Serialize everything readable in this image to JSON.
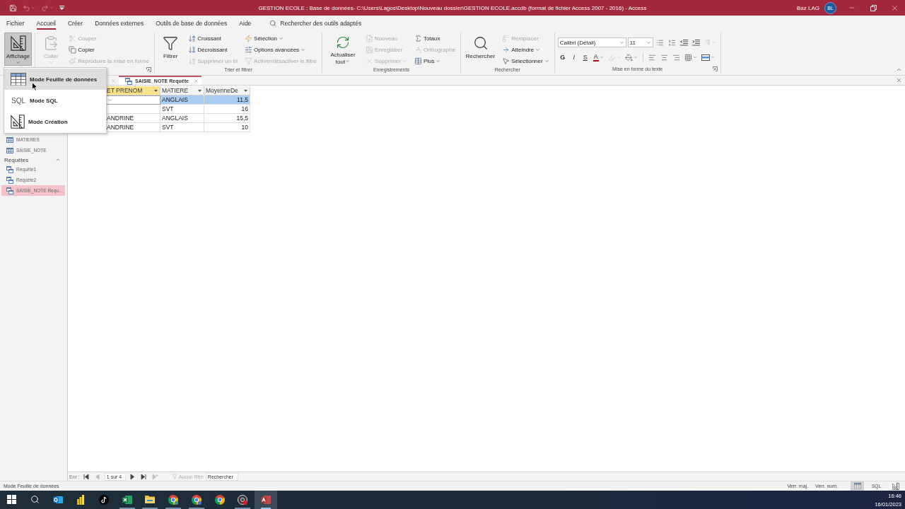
{
  "title_bar": {
    "quick_access": [
      {
        "disabled": false
      },
      {
        "disabled": true
      },
      {
        "disabled": true
      },
      {
        "disabled": false
      }
    ],
    "title": "GESTION ECOLE : Base de données- C:\\Users\\Lagos\\Desktop\\Nouveau dossier\\GESTION ECOLE.accdb (format de fichier Access 2007 - 2016) - Access",
    "user_name": "Baz LAG",
    "avatar_initials": "BL"
  },
  "menu_tabs": [
    {
      "label": "Fichier",
      "selected": false
    },
    {
      "label": "Accueil",
      "selected": true
    },
    {
      "label": "Créer",
      "selected": false
    },
    {
      "label": "Données externes",
      "selected": false
    },
    {
      "label": "Outils de base de données",
      "selected": false
    },
    {
      "label": "Aide",
      "selected": false
    }
  ],
  "tell_me": {
    "placeholder": "Rechercher des outils adaptés"
  },
  "ribbon": {
    "groups": [
      {
        "columns": [
          [
            {
              "kind": "large",
              "label": "Affichage",
              "pressed": true,
              "disabled": false,
              "caret": true
            }
          ]
        ]
      },
      {
        "columns": [
          [
            {
              "kind": "large",
              "label": "Coller",
              "pressed": false,
              "disabled": true,
              "caret": true
            }
          ],
          [
            {
              "kind": "small",
              "label": "Couper",
              "pressed": false,
              "disabled": true,
              "caret": false
            },
            {
              "kind": "small",
              "label": "Copier",
              "pressed": false,
              "disabled": false,
              "caret": false
            },
            {
              "kind": "small",
              "label": "Reproduire la mise en forme",
              "pressed": false,
              "disabled": true,
              "caret": false
            }
          ]
        ],
        "launcher": true
      },
      {
        "label": "Trier et filtrer",
        "columns": [
          [
            {
              "kind": "large",
              "label": "Filtrer",
              "pressed": false,
              "disabled": false,
              "caret": false
            }
          ],
          [
            {
              "kind": "small",
              "label": "Croissant",
              "pressed": false,
              "disabled": false,
              "caret": false
            },
            {
              "kind": "small",
              "label": "Décroissant",
              "pressed": false,
              "disabled": false,
              "caret": false
            },
            {
              "kind": "small",
              "label": "Supprimer un tri",
              "pressed": false,
              "disabled": true,
              "caret": false
            }
          ],
          [
            {
              "kind": "small",
              "label": "Sélection",
              "pressed": false,
              "disabled": false,
              "caret": true
            },
            {
              "kind": "small",
              "label": "Options avancées",
              "pressed": false,
              "disabled": false,
              "caret": true
            },
            {
              "kind": "small",
              "label": "Activer/désactiver le filtre",
              "pressed": false,
              "disabled": true,
              "caret": false
            }
          ]
        ]
      },
      {
        "label": "Enregistrements",
        "columns": [
          [
            {
              "kind": "large",
              "label": "Actualiser tout",
              "pressed": false,
              "disabled": false,
              "caret": true
            }
          ],
          [
            {
              "kind": "small",
              "label": "Nouveau",
              "pressed": false,
              "disabled": true,
              "caret": false
            },
            {
              "kind": "small",
              "label": "Enregistrer",
              "pressed": false,
              "disabled": true,
              "caret": false
            },
            {
              "kind": "small",
              "label": "Supprimer",
              "pressed": false,
              "disabled": true,
              "caret": true
            }
          ],
          [
            {
              "kind": "small",
              "label": "Totaux",
              "pressed": false,
              "disabled": false,
              "caret": false
            },
            {
              "kind": "small",
              "label": "Orthographe",
              "pressed": false,
              "disabled": true,
              "caret": false
            },
            {
              "kind": "small",
              "label": "Plus",
              "pressed": false,
              "disabled": false,
              "caret": true
            }
          ]
        ]
      },
      {
        "label": "Rechercher",
        "columns": [
          [
            {
              "kind": "large",
              "label": "Rechercher",
              "pressed": false,
              "disabled": false,
              "caret": false
            }
          ],
          [
            {
              "kind": "small",
              "label": "Remplacer",
              "pressed": false,
              "disabled": true,
              "caret": false
            },
            {
              "kind": "small",
              "label": "Atteindre",
              "pressed": false,
              "disabled": false,
              "caret": true
            },
            {
              "kind": "small",
              "label": "Sélectionner",
              "pressed": false,
              "disabled": false,
              "caret": true
            }
          ]
        ]
      }
    ]
  },
  "text_group": {
    "label": "Mise en forme du texte",
    "font": "Calibri (Détail)",
    "size": "11",
    "list_tools": [
      {
        "disabled": false
      },
      {
        "disabled": false
      },
      {
        "disabled": false
      },
      {
        "disabled": false
      },
      {
        "disabled": true
      }
    ],
    "style_buttons": [
      {
        "label": "G",
        "kind": "bold"
      },
      {
        "label": "I",
        "kind": "italic"
      },
      {
        "label": "S",
        "kind": "underline"
      }
    ],
    "font_color": {
      "label": "A"
    },
    "color_tools": [
      {
        "disabled": true
      },
      {
        "disabled": false
      }
    ],
    "align_tools": [
      {
        "disabled": false
      },
      {
        "disabled": false
      },
      {
        "disabled": false
      }
    ],
    "grid_tools": [
      {
        "disabled": false
      },
      {
        "disabled": false
      }
    ],
    "launcher": true
  },
  "view_menu": {
    "items": [
      {
        "label": "Mode Feuille de données",
        "selected": true
      },
      {
        "label": "Mode SQL",
        "icon_text": "SQL",
        "selected": false
      },
      {
        "label": "Mode Création",
        "selected": false
      }
    ]
  },
  "nav_pane": {
    "groups": [
      {
        "items": [
          {
            "kind": "table",
            "label": "MATIERES",
            "selected": false
          },
          {
            "kind": "table",
            "label": "SAISIE_NOTE",
            "selected": false
          }
        ]
      },
      {
        "label": "Requêtes",
        "expanded": true,
        "items": [
          {
            "kind": "query",
            "label": "Requête1",
            "selected": false
          },
          {
            "kind": "query",
            "label": "Requête2",
            "selected": false
          },
          {
            "kind": "query",
            "label": "SAISIE_NOTE Requ...",
            "selected": true
          }
        ]
      }
    ]
  },
  "document_tabs": [
    {
      "selected": false
    },
    {
      "label": "SAISIE_NOTE Requête",
      "selected": true
    }
  ],
  "datasheet": {
    "columns": [
      {
        "label": "ET PRENOM",
        "kind": "text",
        "selected": true
      },
      {
        "label": "MATIERE",
        "kind": "text",
        "selected": false
      },
      {
        "label": "MoyenneDe",
        "kind": "number",
        "selected": false
      }
    ],
    "rows": [
      {
        "current": true,
        "cells": [
          {
            "selected": false
          },
          {
            "text": "ANGLAIS",
            "selected": true
          },
          {
            "text": "11,5",
            "selected": true
          }
        ]
      },
      {
        "current": false,
        "cells": [
          {
            "selected": false
          },
          {
            "text": "SVT",
            "selected": false
          },
          {
            "text": "16",
            "selected": false
          }
        ]
      },
      {
        "current": false,
        "cells": [
          {
            "text": "ANDRINE",
            "selected": false
          },
          {
            "text": "ANGLAIS",
            "selected": false
          },
          {
            "text": "15,5",
            "selected": false
          }
        ]
      },
      {
        "current": false,
        "cells": [
          {
            "text": "ANDRINE",
            "selected": false
          },
          {
            "text": "SVT",
            "selected": false
          },
          {
            "text": "10",
            "selected": false
          }
        ]
      }
    ]
  },
  "record_nav": {
    "label": "Enr :",
    "buttons": [
      {
        "disabled": false
      },
      {
        "disabled": true
      },
      {
        "disabled": false
      },
      {
        "disabled": false
      },
      {
        "disabled": true
      }
    ],
    "position": "1 sur 4",
    "filter": {
      "label": "Aucun filtre",
      "disabled": true
    },
    "search": {
      "placeholder": "Rechercher"
    }
  },
  "status_bar": {
    "text": "Mode Feuille de données",
    "indicators": [
      "Verr. maj.",
      "Verr. num."
    ],
    "views": [
      {
        "selected": true
      },
      {
        "label": "SQL",
        "selected": false
      },
      {
        "selected": false
      }
    ]
  },
  "taskbar": {
    "apps": [
      {
        "running": false,
        "active": false
      },
      {
        "running": false,
        "active": false
      },
      {
        "running": false,
        "active": false
      },
      {
        "running": true,
        "active": false
      },
      {
        "running": true,
        "active": false
      },
      {
        "running": true,
        "active": false
      },
      {
        "running": true,
        "active": false
      },
      {
        "running": false,
        "active": false
      },
      {
        "running": true,
        "active": false
      },
      {
        "running": true,
        "active": true
      }
    ],
    "time": "16:46",
    "date": "16/01/2023"
  }
}
